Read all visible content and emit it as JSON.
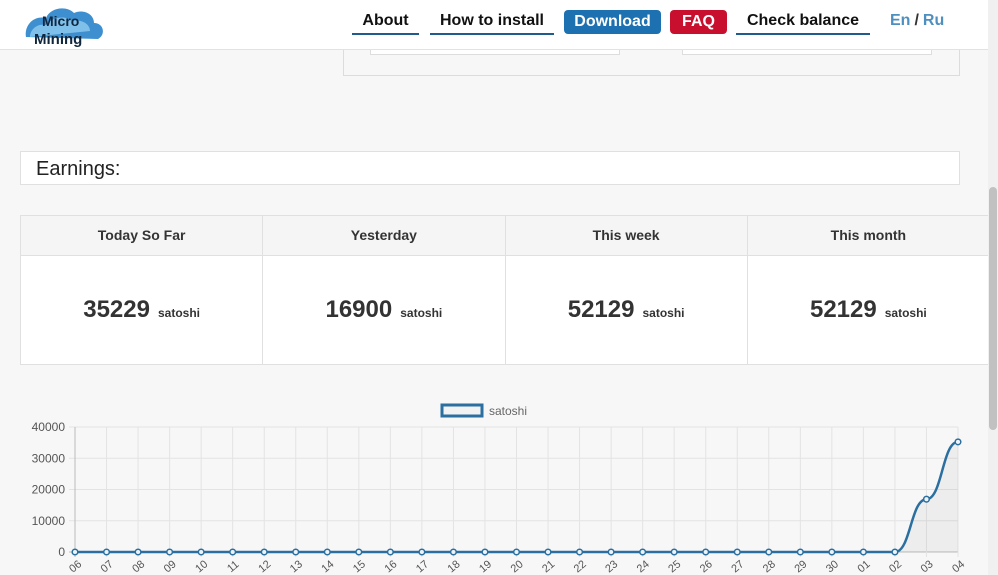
{
  "header": {
    "logo_line1": "Micro",
    "logo_line2": "Mining",
    "nav": {
      "about": "About",
      "how_to_install": "How to install",
      "download": "Download",
      "faq": "FAQ",
      "check_balance": "Check balance"
    },
    "lang": {
      "en": "En",
      "sep": "/",
      "ru": "Ru"
    }
  },
  "earnings": {
    "title": "Earnings:",
    "columns": [
      {
        "label": "Today So Far",
        "value": "35229",
        "unit": "satoshi"
      },
      {
        "label": "Yesterday",
        "value": "16900",
        "unit": "satoshi"
      },
      {
        "label": "This week",
        "value": "52129",
        "unit": "satoshi"
      },
      {
        "label": "This month",
        "value": "52129",
        "unit": "satoshi"
      }
    ]
  },
  "colors": {
    "download_bg": "#1e71b1",
    "faq_bg": "#c8102e",
    "line": "#2a6f9f",
    "accent": "#4f8fbf"
  },
  "chart_data": {
    "type": "line",
    "legend": "satoshi",
    "x": [
      "06",
      "07",
      "08",
      "09",
      "10",
      "11",
      "12",
      "13",
      "14",
      "15",
      "16",
      "17",
      "18",
      "19",
      "20",
      "21",
      "22",
      "23",
      "24",
      "25",
      "26",
      "27",
      "28",
      "29",
      "30",
      "01",
      "02",
      "03",
      "04"
    ],
    "values": [
      0,
      0,
      0,
      0,
      0,
      0,
      0,
      0,
      0,
      0,
      0,
      0,
      0,
      0,
      0,
      0,
      0,
      0,
      0,
      0,
      0,
      0,
      0,
      0,
      0,
      0,
      0,
      16900,
      35229
    ],
    "ylim": [
      0,
      40000
    ],
    "yticks": [
      "0",
      "10000",
      "20000",
      "30000",
      "40000"
    ],
    "grid": true,
    "legend_position": "top"
  }
}
